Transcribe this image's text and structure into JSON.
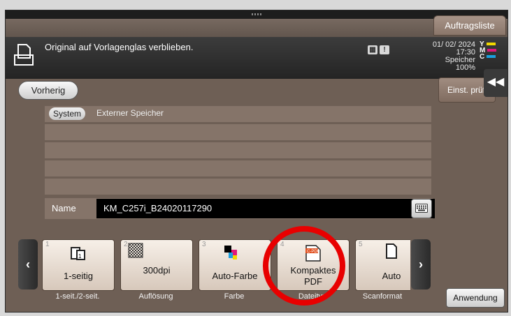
{
  "header": {
    "job_list_label": "Auftragsliste",
    "message": "Original auf Vorlagenglas verblieben.",
    "date": "01/ 02/ 2024",
    "time": "17:30",
    "memory_label": "Speicher",
    "memory_value": "100%",
    "toner": [
      {
        "letter": "Y",
        "color": "#f2d800"
      },
      {
        "letter": "M",
        "color": "#e0187a"
      },
      {
        "letter": "C",
        "color": "#1aa0e0"
      }
    ],
    "check_settings_label": "Einst. prüfen"
  },
  "nav": {
    "back_label": "Vorherig"
  },
  "path": {
    "chip": "System",
    "location": "Externer Speicher"
  },
  "name_field": {
    "label": "Name",
    "value": "KM_C257i_B24020117290"
  },
  "cards": [
    {
      "num": "1",
      "value": "1-seitig",
      "label": "1-seit./2-seit.",
      "icon": "duplex-icon"
    },
    {
      "num": "2",
      "value": "300dpi",
      "label": "Auflösung",
      "icon": "resolution-icon"
    },
    {
      "num": "3",
      "value": "Auto-Farbe",
      "label": "Farbe",
      "icon": "color-icon"
    },
    {
      "num": "4",
      "value": "Kompaktes PDF",
      "value_line1": "Kompaktes",
      "value_line2": "PDF",
      "label": "Dateityp",
      "icon": "compact-pdf-icon",
      "icon_text": "C-PDF"
    },
    {
      "num": "5",
      "value": "Auto",
      "label": "Scanformat",
      "icon": "page-icon"
    }
  ],
  "apply_label": "Anwendung",
  "colors": {
    "highlight": "#e80000",
    "background": "#6e5f55"
  }
}
